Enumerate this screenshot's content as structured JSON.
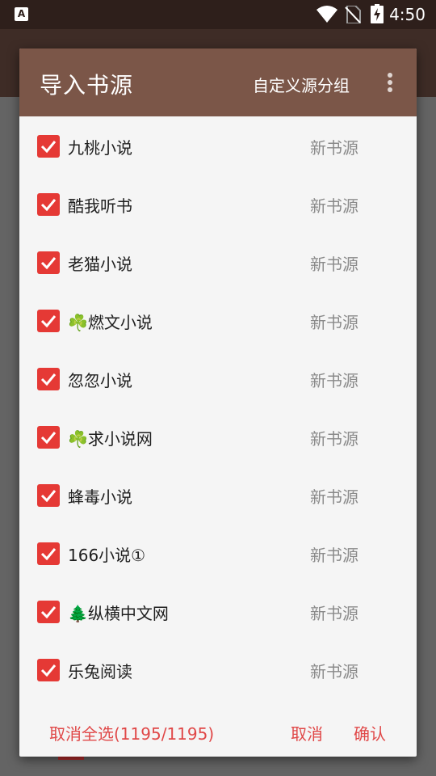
{
  "status_bar": {
    "time": "4:50",
    "app_icon_letter": "A"
  },
  "dialog": {
    "title": "导入书源",
    "group_button": "自定义源分组",
    "items": [
      {
        "name": "九桃小说",
        "status": "新书源",
        "checked": true
      },
      {
        "name": "酷我听书",
        "status": "新书源",
        "checked": true
      },
      {
        "name": "老猫小说",
        "status": "新书源",
        "checked": true
      },
      {
        "name": "☘️燃文小说",
        "status": "新书源",
        "checked": true
      },
      {
        "name": "忽忽小说",
        "status": "新书源",
        "checked": true
      },
      {
        "name": "☘️求小说网",
        "status": "新书源",
        "checked": true
      },
      {
        "name": "蜂毒小说",
        "status": "新书源",
        "checked": true
      },
      {
        "name": "166小说①",
        "status": "新书源",
        "checked": true
      },
      {
        "name": "🌲纵横中文网",
        "status": "新书源",
        "checked": true
      },
      {
        "name": "乐兔阅读",
        "status": "新书源",
        "checked": true
      }
    ],
    "footer": {
      "deselect_all": "取消全选(1195/1195)",
      "cancel": "取消",
      "confirm": "确认"
    }
  },
  "colors": {
    "header": "#7b5648",
    "checkbox": "#e53935",
    "button_text": "#e04848",
    "status_bar": "#2e1f1b"
  },
  "icons": {
    "status_bar": [
      "app-notification-icon",
      "wifi-icon",
      "no-sim-icon",
      "battery-charging-icon"
    ],
    "dialog": [
      "more-vert-icon",
      "checkbox-checked-icon"
    ]
  }
}
